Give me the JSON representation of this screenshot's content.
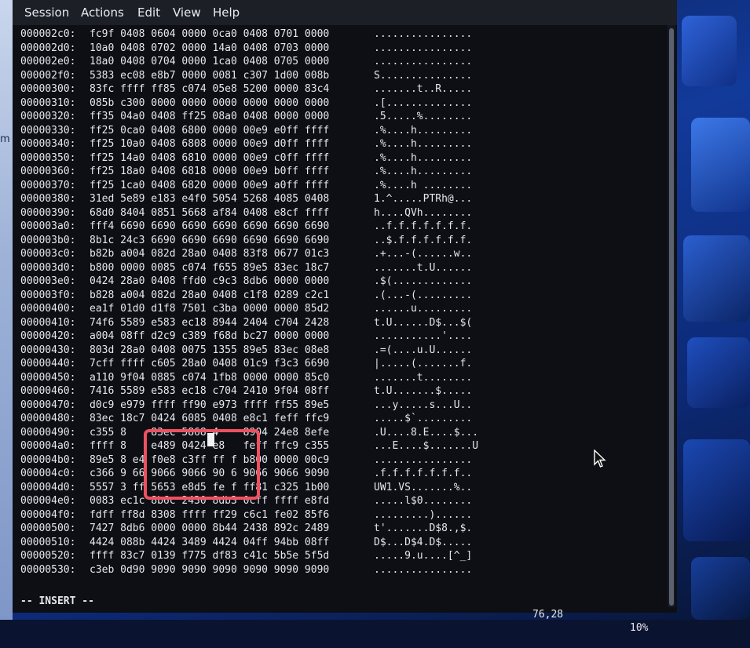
{
  "menu": [
    "Session",
    "Actions",
    "Edit",
    "View",
    "Help"
  ],
  "lines": [
    {
      "addr": "000002c0:",
      "hex": "fc9f 0408 0604 0000 0ca0 0408 0701 0000",
      "ascii": "................"
    },
    {
      "addr": "000002d0:",
      "hex": "10a0 0408 0702 0000 14a0 0408 0703 0000",
      "ascii": "................"
    },
    {
      "addr": "000002e0:",
      "hex": "18a0 0408 0704 0000 1ca0 0408 0705 0000",
      "ascii": "................"
    },
    {
      "addr": "000002f0:",
      "hex": "5383 ec08 e8b7 0000 0081 c307 1d00 008b",
      "ascii": "S..............."
    },
    {
      "addr": "00000300:",
      "hex": "83fc ffff ff85 c074 05e8 5200 0000 83c4",
      "ascii": ".......t..R....."
    },
    {
      "addr": "00000310:",
      "hex": "085b c300 0000 0000 0000 0000 0000 0000",
      "ascii": ".[.............."
    },
    {
      "addr": "00000320:",
      "hex": "ff35 04a0 0408 ff25 08a0 0408 0000 0000",
      "ascii": ".5.....%........"
    },
    {
      "addr": "00000330:",
      "hex": "ff25 0ca0 0408 6800 0000 00e9 e0ff ffff",
      "ascii": ".%....h........."
    },
    {
      "addr": "00000340:",
      "hex": "ff25 10a0 0408 6808 0000 00e9 d0ff ffff",
      "ascii": ".%....h........."
    },
    {
      "addr": "00000350:",
      "hex": "ff25 14a0 0408 6810 0000 00e9 c0ff ffff",
      "ascii": ".%....h........."
    },
    {
      "addr": "00000360:",
      "hex": "ff25 18a0 0408 6818 0000 00e9 b0ff ffff",
      "ascii": ".%....h........."
    },
    {
      "addr": "00000370:",
      "hex": "ff25 1ca0 0408 6820 0000 00e9 a0ff ffff",
      "ascii": ".%....h ........"
    },
    {
      "addr": "00000380:",
      "hex": "31ed 5e89 e183 e4f0 5054 5268 4085 0408",
      "ascii": "1.^.....PTRh@..."
    },
    {
      "addr": "00000390:",
      "hex": "68d0 8404 0851 5668 af84 0408 e8cf ffff",
      "ascii": "h....QVh........"
    },
    {
      "addr": "000003a0:",
      "hex": "fff4 6690 6690 6690 6690 6690 6690 6690",
      "ascii": "..f.f.f.f.f.f.f."
    },
    {
      "addr": "000003b0:",
      "hex": "8b1c 24c3 6690 6690 6690 6690 6690 6690",
      "ascii": "..$.f.f.f.f.f.f."
    },
    {
      "addr": "000003c0:",
      "hex": "b82b a004 082d 28a0 0408 83f8 0677 01c3",
      "ascii": ".+...-(......w.."
    },
    {
      "addr": "000003d0:",
      "hex": "b800 0000 0085 c074 f655 89e5 83ec 18c7",
      "ascii": ".......t.U......"
    },
    {
      "addr": "000003e0:",
      "hex": "0424 28a0 0408 ffd0 c9c3 8db6 0000 0000",
      "ascii": ".$(............."
    },
    {
      "addr": "000003f0:",
      "hex": "b828 a004 082d 28a0 0408 c1f8 0289 c2c1",
      "ascii": ".(...-(........."
    },
    {
      "addr": "00000400:",
      "hex": "ea1f 01d0 d1f8 7501 c3ba 0000 0000 85d2",
      "ascii": "......u........."
    },
    {
      "addr": "00000410:",
      "hex": "74f6 5589 e583 ec18 8944 2404 c704 2428",
      "ascii": "t.U......D$...$("
    },
    {
      "addr": "00000420:",
      "hex": "a004 08ff d2c9 c389 f68d bc27 0000 0000",
      "ascii": "...........'...."
    },
    {
      "addr": "00000430:",
      "hex": "803d 28a0 0408 0075 1355 89e5 83ec 08e8",
      "ascii": ".=(....u.U......"
    },
    {
      "addr": "00000440:",
      "hex": "7cff ffff c605 28a0 0408 01c9 f3c3 6690",
      "ascii": "|.....(.......f."
    },
    {
      "addr": "00000450:",
      "hex": "a110 9f04 0885 c074 1fb8 0000 0000 85c0",
      "ascii": ".......t........"
    },
    {
      "addr": "00000460:",
      "hex": "7416 5589 e583 ec18 c704 2410 9f04 08ff",
      "ascii": "t.U.......$....."
    },
    {
      "addr": "00000470:",
      "hex": "d0c9 e979 ffff ff90 e973 ffff ff55 89e5",
      "ascii": "...y.....s...U.."
    },
    {
      "addr": "00000480:",
      "hex": "83ec 18c7 0424 6085 0408 e8c1 feff ffc9",
      "ascii": ".....$`........."
    },
    {
      "addr": "00000490:",
      "hex": "c355 8    83ec 5868 4    8904 24e8 8efe",
      "ascii": ".U....8.E....$..."
    },
    {
      "addr": "000004a0:",
      "hex": "ffff 8    e489 0424 e8   feff ffc9 c355",
      "ascii": "...E....$.......U"
    },
    {
      "addr": "000004b0:",
      "hex": "89e5 8 e4 f0e8 c3ff ff f b800 0000 00c9",
      "ascii": "................"
    },
    {
      "addr": "000004c0:",
      "hex": "c366 9 66 9066 9066 90 6 9066 9066 9090",
      "ascii": ".f.f.f.f.f.f.f.."
    },
    {
      "addr": "000004d0:",
      "hex": "5557 3 ff 5653 e8d5 fe f ff81 c325 1b00",
      "ascii": "UW1.VS.......%.."
    },
    {
      "addr": "000004e0:",
      "hex": "0083 ec1c 8b6c 2430 8db3 0cff ffff e8fd",
      "ascii": ".....l$0........"
    },
    {
      "addr": "000004f0:",
      "hex": "fdff ff8d 8308 ffff ff29 c6c1 fe02 85f6",
      "ascii": ".........)......"
    },
    {
      "addr": "00000500:",
      "hex": "7427 8db6 0000 0000 8b44 2438 892c 2489",
      "ascii": "t'.......D$8.,$."
    },
    {
      "addr": "00000510:",
      "hex": "4424 088b 4424 3489 4424 04ff 94bb 08ff",
      "ascii": "D$...D$4.D$....."
    },
    {
      "addr": "00000520:",
      "hex": "ffff 83c7 0139 f775 df83 c41c 5b5e 5f5d",
      "ascii": ".....9.u....[^_]"
    },
    {
      "addr": "00000530:",
      "hex": "c3eb 0d90 9090 9090 9090 9090 9090 9090",
      "ascii": "................"
    }
  ],
  "status": {
    "mode": "-- INSERT --",
    "position": "76,28",
    "percent": "10%"
  },
  "colors": {
    "highlight": "#ef5060",
    "terminal_bg": "#0d0f14",
    "text": "#e6e8ec"
  }
}
